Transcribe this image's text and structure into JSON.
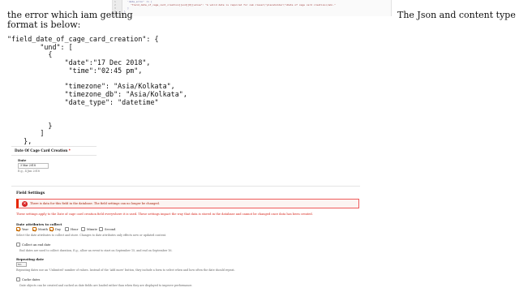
{
  "code": {
    "line_numbers": [
      "1",
      "2",
      "3",
      "4",
      "5"
    ],
    "lines": [
      "'date_error' => [",
      "  \"field_date_of_cage_card_creation][und][0][value\": \"A valid date is required for <em class=\\\"placeholder\\\">Date of cage card creation</em>.\"",
      "  ]",
      "}"
    ]
  },
  "question": {
    "left_line1": "the error which iam getting",
    "left_line2": "format is below:",
    "right": "The Json and content type"
  },
  "json_block": "\"field_date_of_cage_card_creation\": {\n        \"und\": [\n          {\n              \"date\":\"17 Dec 2018\",\n               \"time\":\"02:45 pm\",\n\n              \"timezone\": \"Asia/Kolkata\",\n              \"timezone_db\": \"Asia/Kolkata\",\n              \"date_type\": \"datetime\"\n\n\n          }\n        ]\n    },",
  "form": {
    "field_title": "Date Of Cage Card Creation",
    "required_mark": "*",
    "date_label": "Date",
    "date_value": "3 Mar 2018",
    "date_example": "E.g., 4 Jun 2018",
    "field_settings_title": "Field Settings",
    "error_message": "There is data for this field in the database. The field settings can no longer be changed.",
    "warning_message": "These settings apply to the Date of cage card creation field everywhere it is used. These settings impact the way that data is stored in the database and cannot be changed once data has been created.",
    "attributes_title": "Date attributes to collect",
    "attributes": [
      {
        "label": "Year",
        "checked": true
      },
      {
        "label": "Month",
        "checked": true
      },
      {
        "label": "Day",
        "checked": true
      },
      {
        "label": "Hour",
        "checked": false
      },
      {
        "label": "Minute",
        "checked": false
      },
      {
        "label": "Second",
        "checked": false
      }
    ],
    "attributes_hint": "Select the date attributes to collect and store. Changes to date attributes only effects new or updated content.",
    "end_date_label": "Collect an end date",
    "end_date_hint": "End dates are used to collect duration, E.g., allow an event to start on September 15, and end on September 16.",
    "repeating_title": "Repeating date",
    "repeating_value": "No",
    "repeating_hint": "Repeating dates use an 'Unlimited' number of values. Instead of the 'Add more' button, they include a form to select when and how often the date should repeat.",
    "cache_label": "Cache dates",
    "cache_hint": "Date objects can be created and cached as date fields are loaded rather than when they are displayed to improve performance."
  },
  "colors": {
    "error_red": "#e62600",
    "warning_red": "#d7261b",
    "checkbox_orange": "#c86a00"
  }
}
